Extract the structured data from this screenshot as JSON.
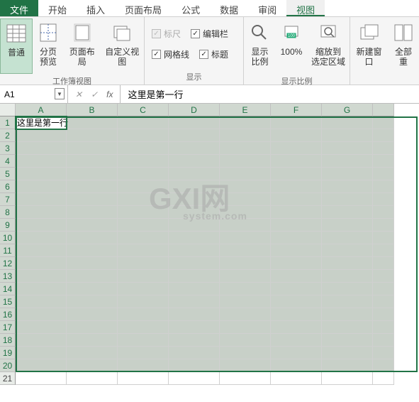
{
  "tabs": {
    "file": "文件",
    "home": "开始",
    "insert": "插入",
    "page_layout": "页面布局",
    "formulas": "公式",
    "data": "数据",
    "review": "审阅",
    "view": "视图"
  },
  "ribbon": {
    "group1_label": "工作簿视图",
    "normal": "普通",
    "page_break": "分页\n预览",
    "page_layout": "页面布局",
    "custom_views": "自定义视图",
    "group2_label": "显示",
    "ruler": "标尺",
    "formula_bar": "编辑栏",
    "gridlines": "网格线",
    "headings": "标题",
    "group3_label": "显示比例",
    "zoom": "显示比例",
    "hundred": "100%",
    "zoom_selection": "缩放到\n选定区域",
    "new_window": "新建窗口",
    "arrange_all": "全部重"
  },
  "name_box": "A1",
  "formula_value": "这里是第一行",
  "columns": [
    "A",
    "B",
    "C",
    "D",
    "E",
    "F",
    "G",
    ""
  ],
  "rows": [
    "1",
    "2",
    "3",
    "4",
    "5",
    "6",
    "7",
    "8",
    "9",
    "10",
    "11",
    "12",
    "13",
    "14",
    "15",
    "16",
    "17",
    "18",
    "19",
    "20",
    "21"
  ],
  "cells": {
    "A1": "这里是第一行"
  },
  "selection": {
    "r1": 1,
    "c1": 1,
    "r2": 20,
    "c2": 8
  },
  "active_cell": "A1",
  "watermark": {
    "main": "GXI网",
    "sub": "system.com"
  },
  "colors": {
    "brand": "#217346"
  }
}
